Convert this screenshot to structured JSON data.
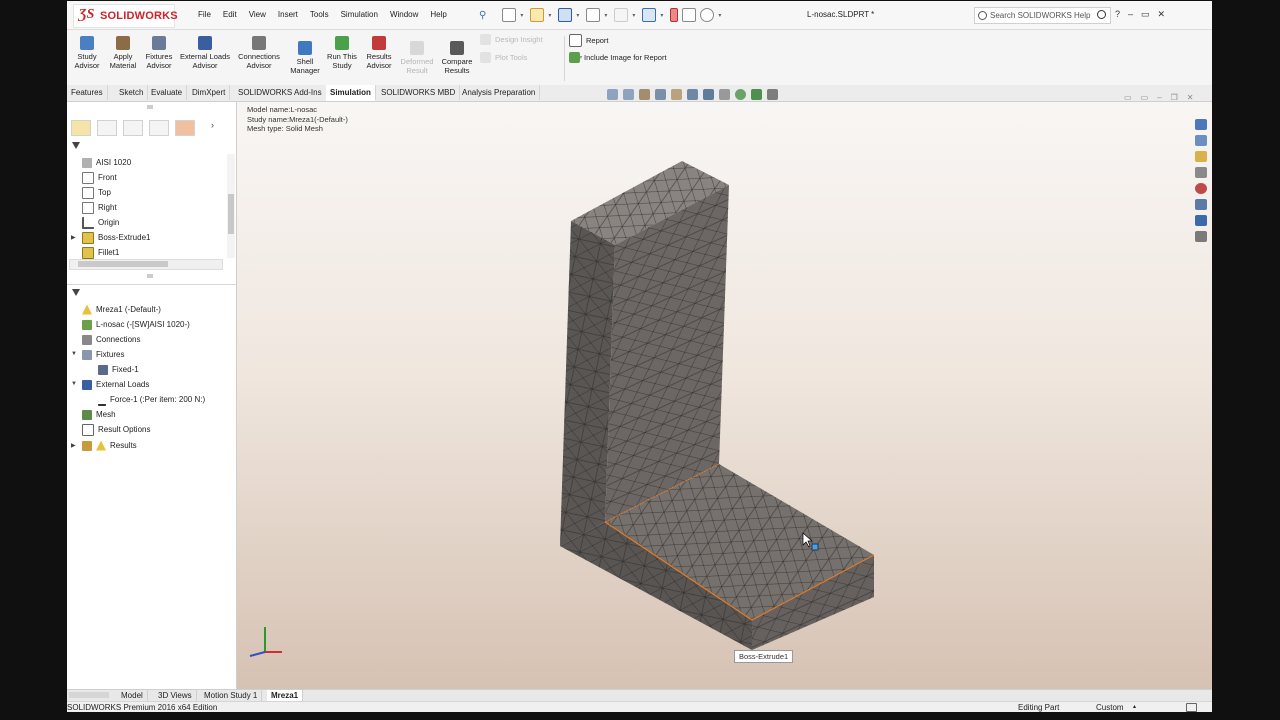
{
  "app": {
    "brand": "SOLIDWORKS",
    "document_title": "L-nosac.SLDPRT *"
  },
  "menu": [
    "File",
    "Edit",
    "View",
    "Insert",
    "Tools",
    "Simulation",
    "Window",
    "Help"
  ],
  "search": {
    "placeholder": "Search SOLIDWORKS Help"
  },
  "window_controls": [
    "?",
    "–",
    "▭",
    "✕"
  ],
  "command_manager": {
    "buttons": [
      {
        "label1": "Study",
        "label2": "Advisor",
        "icon_color": "#4a7fc1",
        "disabled": false
      },
      {
        "label1": "Apply",
        "label2": "Material",
        "icon_color": "#7a5b3a",
        "disabled": false
      },
      {
        "label1": "Fixtures",
        "label2": "Advisor",
        "icon_color": "#5a6a8a",
        "disabled": false
      },
      {
        "label1": "External Loads",
        "label2": "Advisor",
        "icon_color": "#3a5fa0",
        "disabled": false
      },
      {
        "label1": "Connections",
        "label2": "Advisor",
        "icon_color": "#6a6a6a",
        "disabled": false
      },
      {
        "label1": "Shell",
        "label2": "Manager",
        "icon_color": "#3f7ac0",
        "disabled": false
      },
      {
        "label1": "Run This",
        "label2": "Study",
        "icon_color": "#4aa14a",
        "disabled": false
      },
      {
        "label1": "Results",
        "label2": "Advisor",
        "icon_color": "#c23b3b",
        "disabled": false
      },
      {
        "label1": "Deformed",
        "label2": "Result",
        "icon_color": "#c8c8c8",
        "disabled": true
      },
      {
        "label1": "Compare",
        "label2": "Results",
        "icon_color": "#5a5a5a",
        "disabled": false
      }
    ],
    "small_buttons": [
      {
        "label": "Design Insight",
        "disabled": true
      },
      {
        "label": "Plot Tools",
        "disabled": true
      },
      {
        "label": "Report",
        "disabled": false
      },
      {
        "label": "Include Image for Report",
        "disabled": false
      }
    ]
  },
  "tabs": [
    {
      "label": "Features",
      "active": false
    },
    {
      "label": "Sketch",
      "active": false
    },
    {
      "label": "Evaluate",
      "active": false
    },
    {
      "label": "DimXpert",
      "active": false
    },
    {
      "label": "SOLIDWORKS Add-Ins",
      "active": false
    },
    {
      "label": "Simulation",
      "active": true
    },
    {
      "label": "SOLIDWORKS MBD",
      "active": false
    },
    {
      "label": "Analysis Preparation",
      "active": false
    }
  ],
  "feature_tree": [
    {
      "label": "AISI 1020",
      "icon": "material-icon",
      "expandable": false
    },
    {
      "label": "Front",
      "icon": "plane-icon",
      "expandable": false
    },
    {
      "label": "Top",
      "icon": "plane-icon",
      "expandable": false
    },
    {
      "label": "Right",
      "icon": "plane-icon",
      "expandable": false
    },
    {
      "label": "Origin",
      "icon": "origin-icon",
      "expandable": false
    },
    {
      "label": "Boss-Extrude1",
      "icon": "extrude-icon",
      "expandable": true
    },
    {
      "label": "Fillet1",
      "icon": "fillet-icon",
      "expandable": false
    }
  ],
  "study_tree": [
    {
      "label": "Mreza1 (-Default-)",
      "icon": "study-warning-icon",
      "expandable": false,
      "indent": 0
    },
    {
      "label": "L-nosac (-[SW]AISI 1020-)",
      "icon": "part-icon",
      "expandable": false,
      "indent": 0
    },
    {
      "label": "Connections",
      "icon": "connections-icon",
      "expandable": false,
      "indent": 0
    },
    {
      "label": "Fixtures",
      "icon": "fixtures-icon",
      "expandable": true,
      "indent": 0
    },
    {
      "label": "Fixed-1",
      "icon": "fixed-icon",
      "expandable": false,
      "indent": 1
    },
    {
      "label": "External Loads",
      "icon": "loads-icon",
      "expandable": true,
      "indent": 0
    },
    {
      "label": "Force-1 (:Per item: 200 N:)",
      "icon": "force-icon",
      "expandable": false,
      "indent": 1
    },
    {
      "label": "Mesh",
      "icon": "mesh-icon",
      "expandable": false,
      "indent": 0
    },
    {
      "label": "Result Options",
      "icon": "result-options-icon",
      "expandable": false,
      "indent": 0
    },
    {
      "label": "Results",
      "icon": "results-icon",
      "expandable": true,
      "indent": 0
    }
  ],
  "viewport": {
    "model_name": "Model name:L-nosac",
    "study_name": "Study name:Mreza1(-Default-)",
    "mesh_type": "Mesh type: Solid Mesh",
    "tooltip": "Boss-Extrude1"
  },
  "bottom_tabs": [
    {
      "label": "Model",
      "active": false
    },
    {
      "label": "3D Views",
      "active": false
    },
    {
      "label": "Motion Study 1",
      "active": false
    },
    {
      "label": "Mreza1",
      "active": true
    }
  ],
  "status": {
    "left": "SOLIDWORKS Premium 2016 x64 Edition",
    "mode": "Editing Part",
    "units": "Custom"
  }
}
